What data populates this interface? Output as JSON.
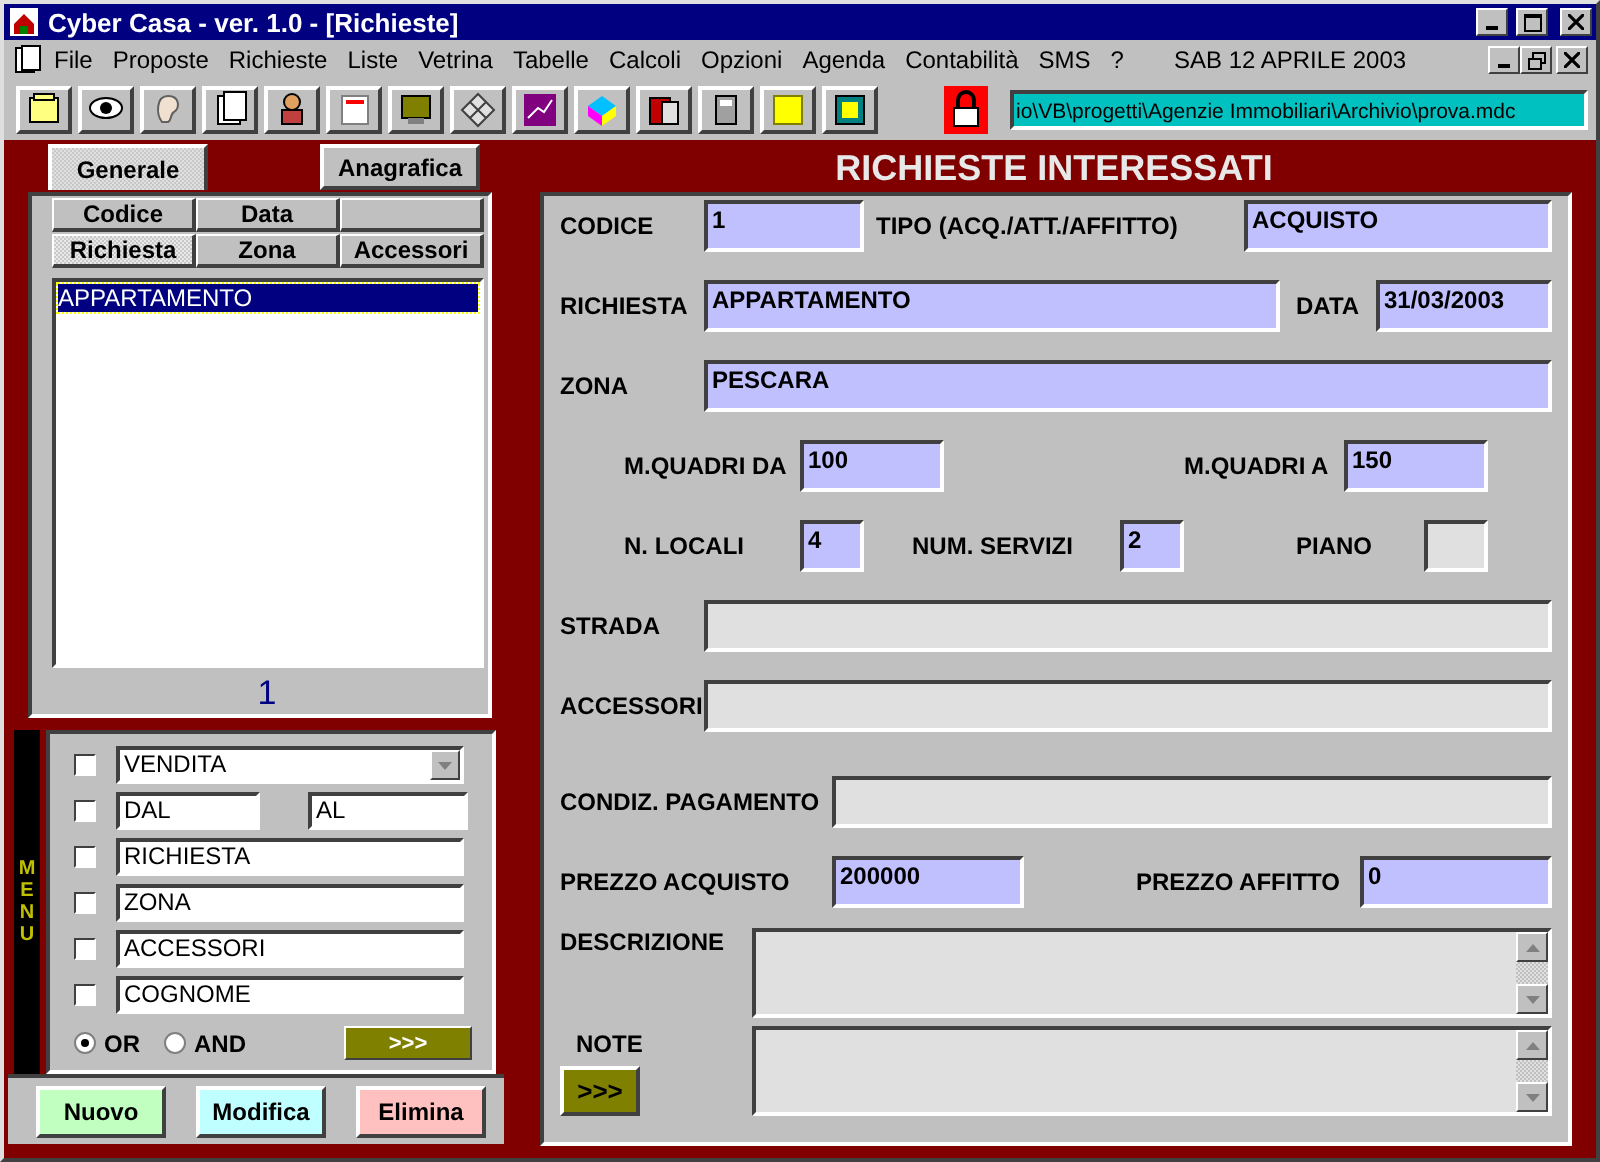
{
  "window": {
    "title": "Cyber Casa - ver. 1.0 - [Richieste]"
  },
  "menu": {
    "items": [
      "File",
      "Proposte",
      "Richieste",
      "Liste",
      "Vetrina",
      "Tabelle",
      "Calcoli",
      "Opzioni",
      "Agenda",
      "Contabilità",
      "SMS",
      "?"
    ],
    "date": "SAB 12 APRILE 2003"
  },
  "toolbar": {
    "path": "io\\VB\\progetti\\Agenzie Immobiliari\\Archivio\\prova.mdc"
  },
  "left_panel": {
    "tabs": [
      {
        "label": "Generale",
        "selected": true
      },
      {
        "label": "Anagrafica",
        "selected": false
      }
    ],
    "sort_buttons": [
      [
        {
          "label": "Codice",
          "selected": false
        },
        {
          "label": "Data",
          "selected": false
        }
      ],
      [
        {
          "label": "Richiesta",
          "selected": true
        },
        {
          "label": "Zona",
          "selected": false
        },
        {
          "label": "Accessori",
          "selected": false
        }
      ]
    ],
    "list": [
      {
        "label": "APPARTAMENTO",
        "selected": true
      }
    ],
    "count": "1"
  },
  "menu_strip": "MENU",
  "filters": [
    {
      "kind": "dropdown",
      "checked": false,
      "value": "VENDITA"
    },
    {
      "kind": "range",
      "checked": false,
      "from": "DAL",
      "to": "AL"
    },
    {
      "kind": "text",
      "checked": false,
      "value": "RICHIESTA"
    },
    {
      "kind": "text",
      "checked": false,
      "value": "ZONA"
    },
    {
      "kind": "text",
      "checked": false,
      "value": "ACCESSORI"
    },
    {
      "kind": "text",
      "checked": false,
      "value": "COGNOME"
    }
  ],
  "logic": [
    {
      "label": "OR",
      "selected": true
    },
    {
      "label": "AND",
      "selected": false
    }
  ],
  "filter_go": ">>>",
  "actions": [
    {
      "label": "Nuovo",
      "color": "#c0ffc0"
    },
    {
      "label": "Modifica",
      "color": "#c0ffff"
    },
    {
      "label": "Elimina",
      "color": "#ffc0c0"
    }
  ],
  "form": {
    "title": "RICHIESTE INTERESSATI",
    "rows": [
      [
        {
          "label": "CODICE",
          "value": "1",
          "highlighted": true
        },
        {
          "label": "TIPO (ACQ./ATT./AFFITTO)",
          "value": "ACQUISTO",
          "highlighted": true
        }
      ],
      [
        {
          "label": "RICHIESTA",
          "value": "APPARTAMENTO",
          "highlighted": true
        },
        {
          "label": "DATA",
          "value": "31/03/2003",
          "highlighted": true
        }
      ],
      [
        {
          "label": "ZONA",
          "value": "PESCARA",
          "highlighted": true
        }
      ],
      [
        {
          "label": "M.QUADRI DA",
          "value": "100",
          "highlighted": true
        },
        {
          "label": "M.QUADRI A",
          "value": "150",
          "highlighted": true
        }
      ],
      [
        {
          "label": "N. LOCALI",
          "value": "4",
          "highlighted": true
        },
        {
          "label": "NUM. SERVIZI",
          "value": "2",
          "highlighted": true
        },
        {
          "label": "PIANO",
          "highlighted": false
        }
      ],
      [
        {
          "label": "STRADA",
          "highlighted": false
        }
      ],
      [
        {
          "label": "ACCESSORI",
          "highlighted": false
        }
      ],
      [
        {
          "label": "CONDIZ. PAGAMENTO",
          "highlighted": false
        }
      ],
      [
        {
          "label": "PREZZO ACQUISTO",
          "value": "200000",
          "highlighted": true
        },
        {
          "label": "PREZZO AFFITTO",
          "value": "0",
          "highlighted": true
        }
      ]
    ],
    "description_label": "DESCRIZIONE",
    "notes_label": "NOTE",
    "notes_button": ">>>"
  }
}
